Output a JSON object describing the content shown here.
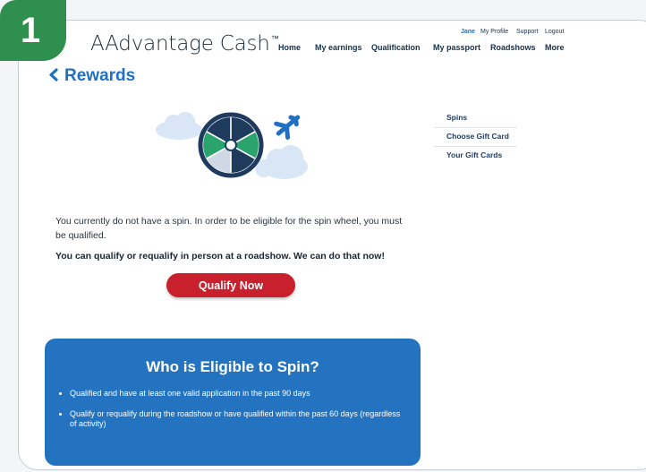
{
  "step_badge": "1",
  "brand": {
    "name": "AAdvantage Cash",
    "mark": "™"
  },
  "header": {
    "nav": [
      "Home",
      "My earnings",
      "Qualification",
      "My passport",
      "Roadshows",
      "More"
    ],
    "util": {
      "user": "Jane",
      "profile": "My Profile",
      "support": "Support",
      "logout": "Logout"
    }
  },
  "page": {
    "title": "Rewards"
  },
  "side_menu": {
    "items": [
      "Spins",
      "Choose Gift Card",
      "Your Gift Cards"
    ]
  },
  "main": {
    "notice": "You currently do not have a spin. In order to be eligible for the spin wheel, you must be qualified.",
    "cta_text": "You can qualify or requalify in person at a roadshow. We can do that now!",
    "qualify_button": "Qualify Now"
  },
  "eligibility": {
    "title": "Who is Eligible to Spin?",
    "bullets": [
      "Qualified and have at least one valid application in the past 90 days",
      "Qualify or requalify during the roadshow or have qualified within the past 60 days (regardless of activity)"
    ]
  },
  "colors": {
    "accent_blue": "#1f6fc3",
    "panel_blue": "#2473c0",
    "cta_red": "#c8202c",
    "badge_green": "#2f8f4f",
    "wheel_green": "#2aa46c",
    "wheel_navy": "#1e3a5c"
  },
  "icons": [
    "chevron-left-icon",
    "spin-wheel-icon",
    "airplane-icon",
    "cloud-icon"
  ]
}
